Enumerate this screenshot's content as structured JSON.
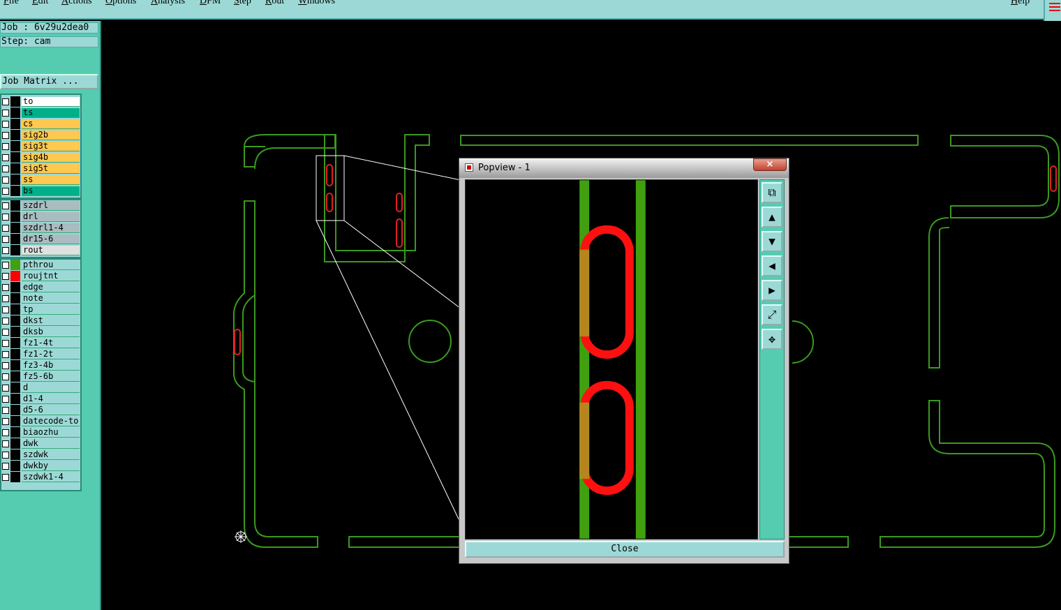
{
  "menu": [
    "File",
    "Edit",
    "Actions",
    "Options",
    "Analysis",
    "DFM",
    "Step",
    "Rout",
    "Windows"
  ],
  "help": "Help",
  "job_label": "Job : 6v29u2dea0",
  "step_label": "Step: cam",
  "job_matrix": "Job Matrix ...",
  "layers": {
    "group1": [
      {
        "name": "to",
        "bg": "#ffffff"
      },
      {
        "name": "ts",
        "bg": "#00b08a"
      },
      {
        "name": "cs",
        "bg": "#ffc850"
      },
      {
        "name": "sig2b",
        "bg": "#ffc850"
      },
      {
        "name": "sig3t",
        "bg": "#ffc850"
      },
      {
        "name": "sig4b",
        "bg": "#ffc850"
      },
      {
        "name": "sig5t",
        "bg": "#ffc850"
      },
      {
        "name": "ss",
        "bg": "#ffc850"
      },
      {
        "name": "bs",
        "bg": "#00b08a"
      }
    ],
    "group2": [
      {
        "name": "szdrl",
        "bg": "#a9bcc0"
      },
      {
        "name": "drl",
        "bg": "#a9bcc0"
      },
      {
        "name": "szdrl1-4",
        "bg": "#a9bcc0"
      },
      {
        "name": "dr15-6",
        "bg": "#a9bcc0"
      },
      {
        "name": "rout",
        "bg": "#e0e0e0"
      }
    ],
    "group3": [
      {
        "name": "pthrou",
        "bg": "#9cd9d6",
        "color": "#40a010"
      },
      {
        "name": "roujtnt",
        "bg": "#9cd9d6",
        "color": "#ff0000"
      },
      {
        "name": "edge",
        "bg": "#9cd9d6"
      },
      {
        "name": "note",
        "bg": "#9cd9d6"
      },
      {
        "name": "tp",
        "bg": "#9cd9d6"
      },
      {
        "name": "dkst",
        "bg": "#9cd9d6"
      },
      {
        "name": "dksb",
        "bg": "#9cd9d6"
      },
      {
        "name": "fz1-4t",
        "bg": "#9cd9d6"
      },
      {
        "name": "fz1-2t",
        "bg": "#9cd9d6"
      },
      {
        "name": "fz3-4b",
        "bg": "#9cd9d6"
      },
      {
        "name": "fz5-6b",
        "bg": "#9cd9d6"
      },
      {
        "name": "d",
        "bg": "#9cd9d6"
      },
      {
        "name": "d1-4",
        "bg": "#9cd9d6"
      },
      {
        "name": "d5-6",
        "bg": "#9cd9d6"
      },
      {
        "name": "datecode-to",
        "bg": "#9cd9d6"
      },
      {
        "name": "biaozhu",
        "bg": "#9cd9d6"
      },
      {
        "name": "dwk",
        "bg": "#9cd9d6"
      },
      {
        "name": "szdwk",
        "bg": "#9cd9d6"
      },
      {
        "name": "dwkby",
        "bg": "#9cd9d6"
      },
      {
        "name": "szdwk1-4",
        "bg": "#9cd9d6"
      }
    ]
  },
  "popview": {
    "title": "Popview - 1",
    "close_x": "×",
    "close_label": "Close",
    "tools": [
      "zoom-home-icon",
      "pan-up-icon",
      "pan-down-icon",
      "pan-left-icon",
      "pan-right-icon",
      "zoom-out-icon",
      "zoom-fit-icon"
    ],
    "tool_glyphs": [
      "⧉",
      "▲",
      "▼",
      "◀",
      "▶",
      "⤢",
      "✥"
    ]
  },
  "colors": {
    "pthrou": "#40a010",
    "roujtnt": "#ff0000",
    "outline": "#3a9a1e"
  }
}
